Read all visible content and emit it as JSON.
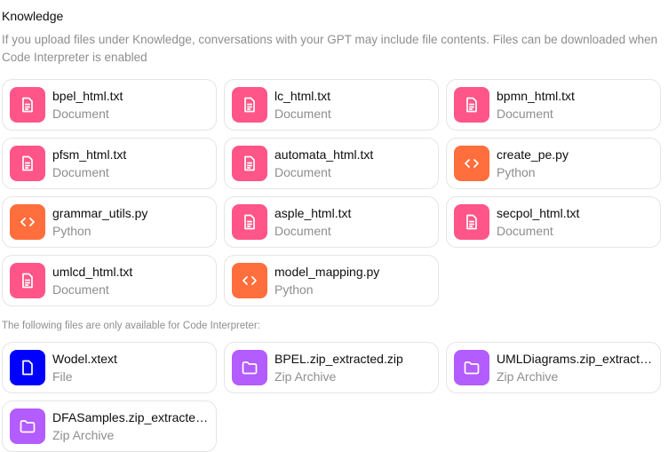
{
  "knowledge": {
    "title": "Knowledge",
    "description": "If you upload files under Knowledge, conversations with your GPT may include file contents. Files can be downloaded when Code Interpreter is enabled"
  },
  "files": [
    {
      "name": "bpel_html.txt",
      "type": "Document",
      "icon": "document-icon",
      "color": "#ff5588"
    },
    {
      "name": "lc_html.txt",
      "type": "Document",
      "icon": "document-icon",
      "color": "#ff5588"
    },
    {
      "name": "bpmn_html.txt",
      "type": "Document",
      "icon": "document-icon",
      "color": "#ff5588"
    },
    {
      "name": "pfsm_html.txt",
      "type": "Document",
      "icon": "document-icon",
      "color": "#ff5588"
    },
    {
      "name": "automata_html.txt",
      "type": "Document",
      "icon": "document-icon",
      "color": "#ff5588"
    },
    {
      "name": "create_pe.py",
      "type": "Python",
      "icon": "code-icon",
      "color": "#ff6e3c"
    },
    {
      "name": "grammar_utils.py",
      "type": "Python",
      "icon": "code-icon",
      "color": "#ff6e3c"
    },
    {
      "name": "asple_html.txt",
      "type": "Document",
      "icon": "document-icon",
      "color": "#ff5588"
    },
    {
      "name": "secpol_html.txt",
      "type": "Document",
      "icon": "document-icon",
      "color": "#ff5588"
    },
    {
      "name": "umlcd_html.txt",
      "type": "Document",
      "icon": "document-icon",
      "color": "#ff5588"
    },
    {
      "name": "model_mapping.py",
      "type": "Python",
      "icon": "code-icon",
      "color": "#ff6e3c"
    }
  ],
  "code_interpreter": {
    "note": "The following files are only available for Code Interpreter:",
    "files": [
      {
        "name": "Wodel.xtext",
        "type": "File",
        "icon": "file-icon",
        "color": "#0000ff"
      },
      {
        "name": "BPEL.zip_extracted.zip",
        "type": "Zip Archive",
        "icon": "folder-icon",
        "color": "#b35cff"
      },
      {
        "name": "UMLDiagrams.zip_extracted.zip",
        "type": "Zip Archive",
        "icon": "folder-icon",
        "color": "#b35cff"
      },
      {
        "name": "DFASamples.zip_extracted.zip",
        "type": "Zip Archive",
        "icon": "folder-icon",
        "color": "#b35cff"
      }
    ]
  }
}
